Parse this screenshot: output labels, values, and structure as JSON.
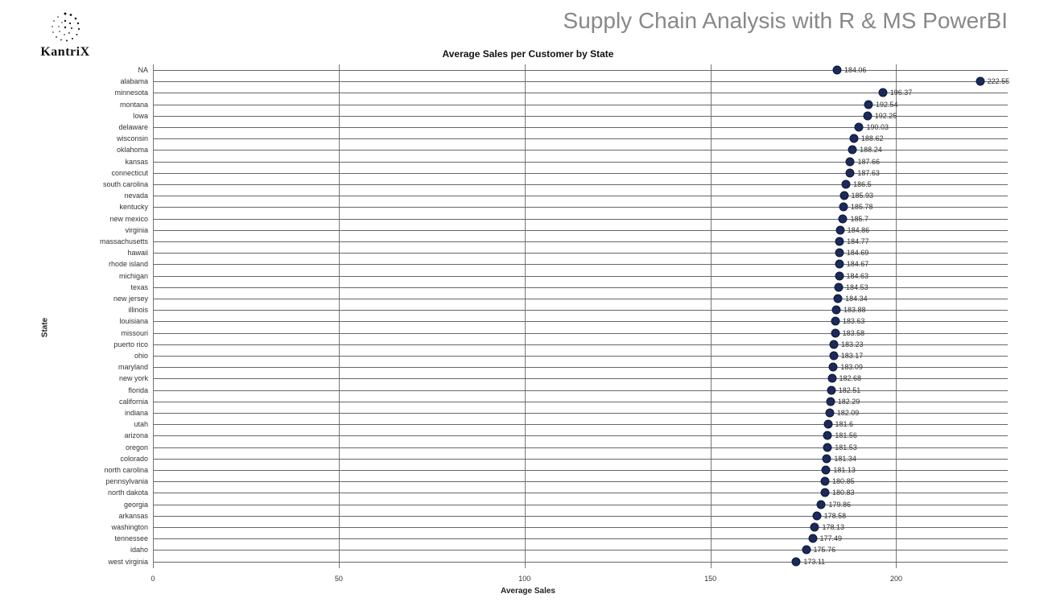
{
  "header": {
    "logo_text": "KantriX",
    "page_title": "Supply Chain Analysis with R & MS PowerBI"
  },
  "chart_data": {
    "type": "scatter",
    "title": "Average Sales per Customer by State",
    "xlabel": "Average Sales",
    "ylabel": "State",
    "xlim": [
      0,
      230
    ],
    "x_ticks": [
      0,
      50,
      100,
      150,
      200
    ],
    "series": [
      {
        "state": "NA",
        "value": 184.06
      },
      {
        "state": "alabama",
        "value": 222.55
      },
      {
        "state": "minnesota",
        "value": 196.37
      },
      {
        "state": "montana",
        "value": 192.54
      },
      {
        "state": "Iowa",
        "value": 192.25
      },
      {
        "state": "delaware",
        "value": 190.03
      },
      {
        "state": "wisconsin",
        "value": 188.62
      },
      {
        "state": "oklahoma",
        "value": 188.24
      },
      {
        "state": "kansas",
        "value": 187.66
      },
      {
        "state": "connecticut",
        "value": 187.63
      },
      {
        "state": "south carolina",
        "value": 186.5
      },
      {
        "state": "nevada",
        "value": 185.93
      },
      {
        "state": "kentucky",
        "value": 185.78
      },
      {
        "state": "new mexico",
        "value": 185.7
      },
      {
        "state": "virginia",
        "value": 184.86
      },
      {
        "state": "massachusetts",
        "value": 184.77
      },
      {
        "state": "hawaii",
        "value": 184.69
      },
      {
        "state": "rhode island",
        "value": 184.67
      },
      {
        "state": "michigan",
        "value": 184.63
      },
      {
        "state": "texas",
        "value": 184.53
      },
      {
        "state": "new jersey",
        "value": 184.34
      },
      {
        "state": "illinois",
        "value": 183.88
      },
      {
        "state": "louisiana",
        "value": 183.63
      },
      {
        "state": "missouri",
        "value": 183.58
      },
      {
        "state": "puerto rico",
        "value": 183.23
      },
      {
        "state": "ohio",
        "value": 183.17
      },
      {
        "state": "maryland",
        "value": 183.09
      },
      {
        "state": "new york",
        "value": 182.68
      },
      {
        "state": "florida",
        "value": 182.51
      },
      {
        "state": "california",
        "value": 182.29
      },
      {
        "state": "indiana",
        "value": 182.09
      },
      {
        "state": "utah",
        "value": 181.6
      },
      {
        "state": "arizona",
        "value": 181.56
      },
      {
        "state": "oregon",
        "value": 181.53
      },
      {
        "state": "colorado",
        "value": 181.34
      },
      {
        "state": "north carolina",
        "value": 181.13
      },
      {
        "state": "pennsylvania",
        "value": 180.85
      },
      {
        "state": "north dakota",
        "value": 180.83
      },
      {
        "state": "georgia",
        "value": 179.86
      },
      {
        "state": "arkansas",
        "value": 178.58
      },
      {
        "state": "washington",
        "value": 178.13
      },
      {
        "state": "tennessee",
        "value": 177.49
      },
      {
        "state": "idaho",
        "value": 175.76
      },
      {
        "state": "west virginia",
        "value": 173.11
      }
    ]
  }
}
